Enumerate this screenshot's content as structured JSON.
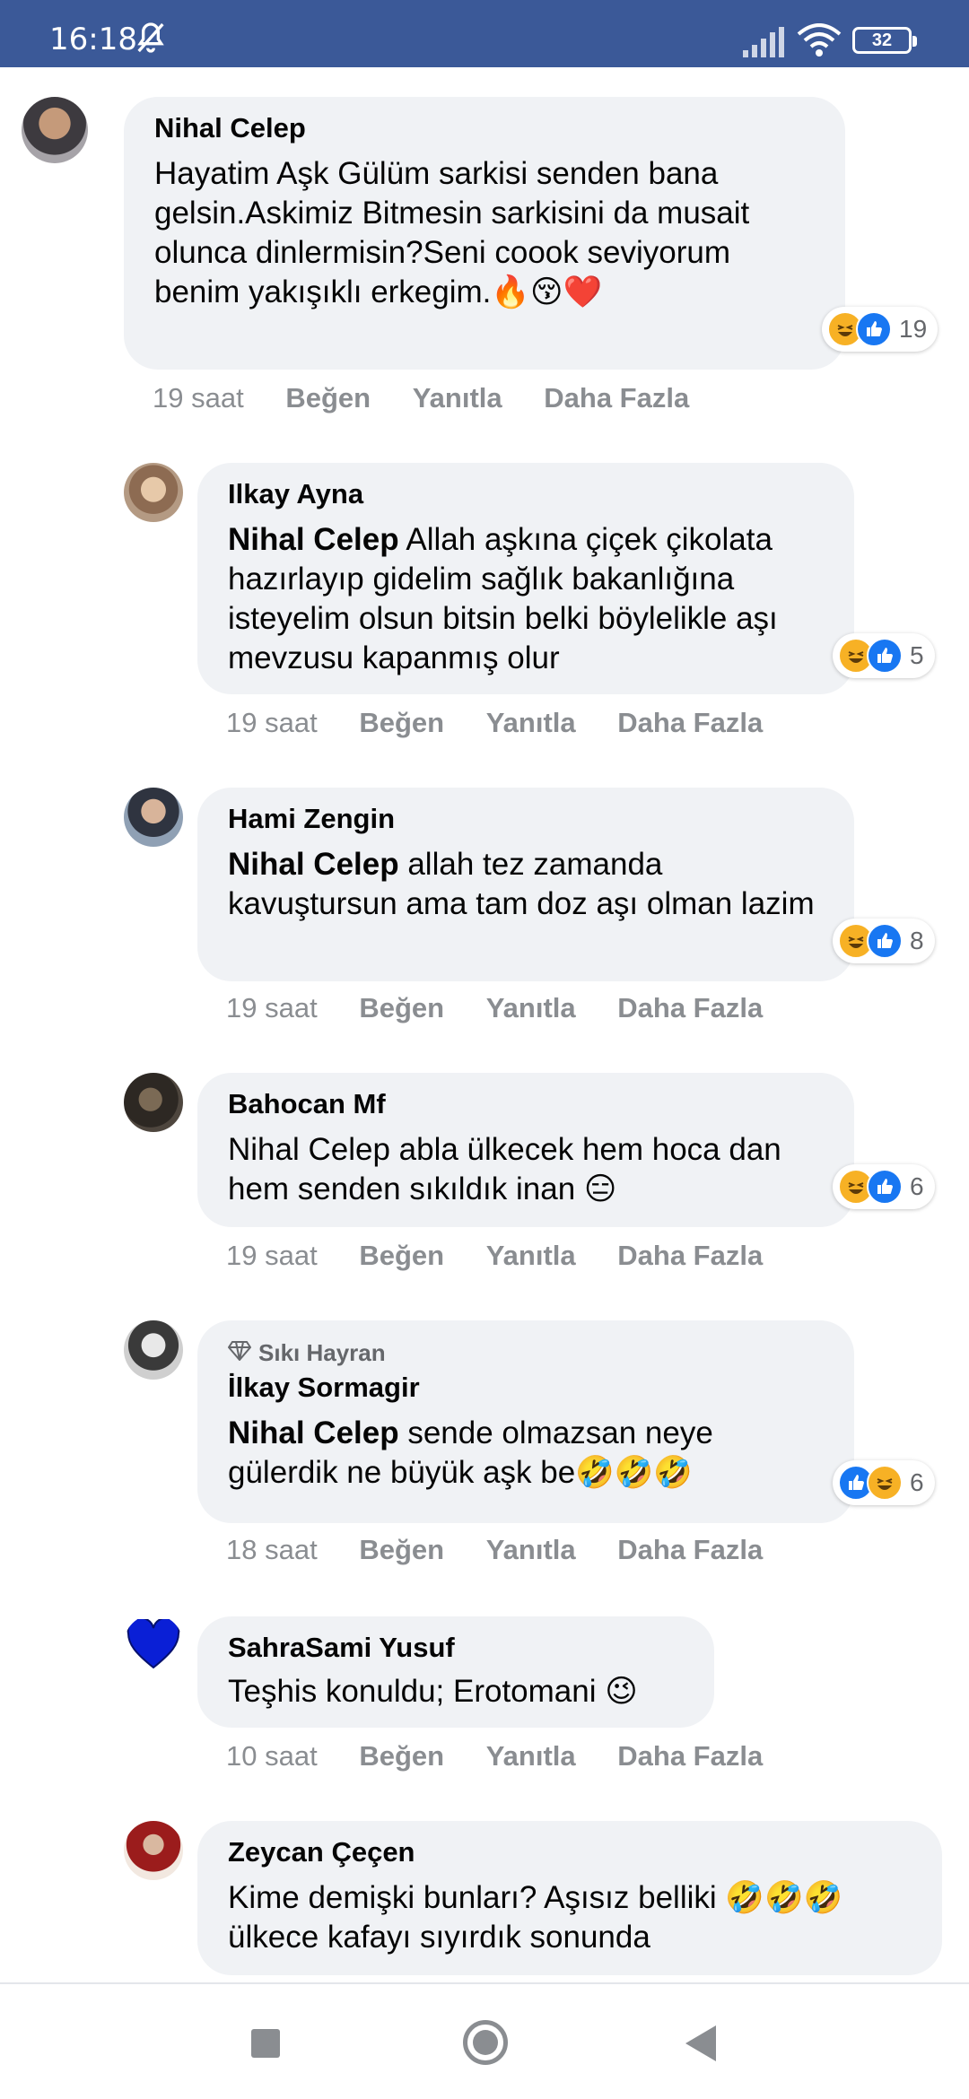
{
  "status_bar": {
    "time": "16:18",
    "battery": "32",
    "bar_color": "#3b5998"
  },
  "comments": [
    {
      "author": "Nihal Celep",
      "fan_badge": "",
      "mention": "",
      "text": "Hayatim Aşk Gülüm sarkisi senden bana gelsin.Askimiz Bitmesin sarkisini da musait olunca dinlermisin?Seni coook seviyorum benim yakışıklı erkegim.🔥😚❤️",
      "time": "19 saat",
      "reactions": "19",
      "reaction_icons": [
        "haha-icon",
        "like-icon"
      ]
    },
    {
      "author": "Ilkay Ayna",
      "fan_badge": "",
      "mention": "Nihal Celep",
      "text": " Allah aşkına çiçek çikolata hazırlayıp gidelim sağlık bakanlığına isteyelim olsun bitsin belki böylelikle aşı mevzusu kapanmış olur",
      "time": "19 saat",
      "reactions": "5",
      "reaction_icons": [
        "haha-icon",
        "like-icon"
      ]
    },
    {
      "author": "Hami Zengin",
      "fan_badge": "",
      "mention": "Nihal Celep",
      "text": " allah tez zamanda kavuştursun ama tam doz aşı olman lazim",
      "time": "19 saat",
      "reactions": "8",
      "reaction_icons": [
        "haha-icon",
        "like-icon"
      ]
    },
    {
      "author": "Bahocan Mf",
      "fan_badge": "",
      "mention": "",
      "text": "Nihal Celep abla ülkecek hem hoca dan hem senden sıkıldık inan 😑",
      "time": "19 saat",
      "reactions": "6",
      "reaction_icons": [
        "haha-icon",
        "like-icon"
      ]
    },
    {
      "author": "İlkay Sormagir",
      "fan_badge": "Sıkı Hayran",
      "mention": "Nihal Celep",
      "text": " sende olmazsan neye gülerdik ne büyük aşk be🤣🤣🤣",
      "time": "18 saat",
      "reactions": "6",
      "reaction_icons": [
        "like-icon",
        "haha-icon"
      ]
    },
    {
      "author": "SahraSami Yusuf",
      "fan_badge": "",
      "mention": "",
      "text": "Teşhis konuldu; Erotomani 😉",
      "time": "10 saat",
      "reactions": "",
      "reaction_icons": []
    },
    {
      "author": "Zeycan Çeçen",
      "fan_badge": "",
      "mention": "",
      "text": "Kime demişki bunları? Aşısız belliki 🤣🤣🤣 ülkece kafayı sıyırdık sonunda",
      "time": "",
      "reactions": "",
      "reaction_icons": []
    }
  ],
  "actions": {
    "like": "Beğen",
    "reply": "Yanıtla",
    "more": "Daha Fazla"
  },
  "colors": {
    "bubble": "#f0f2f5",
    "meta_text": "#8a8d91",
    "like_blue": "#1877f2",
    "haha_yellow": "#f7b125"
  }
}
